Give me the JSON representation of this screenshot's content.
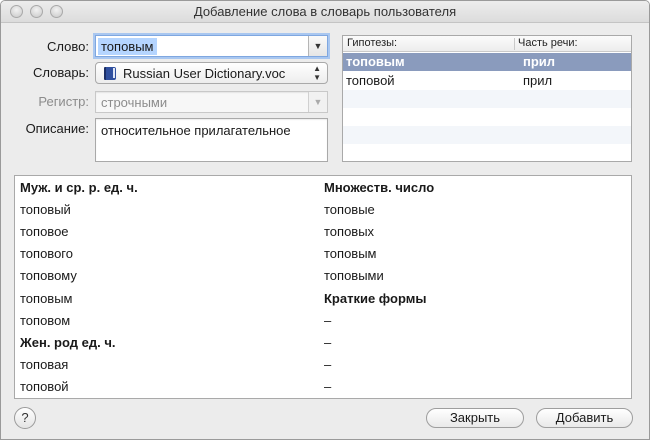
{
  "window": {
    "title": "Добавление слова в словарь пользователя"
  },
  "form": {
    "word_label": "Слово:",
    "word_value": "топовым",
    "dictionary_label": "Словарь:",
    "dictionary_value": "Russian User Dictionary.voc",
    "register_label": "Регистр:",
    "register_value": "строчными",
    "description_label": "Описание:",
    "description_value": "относительное прилагательное"
  },
  "hypotheses": {
    "col_hypotheses": "Гипотезы:",
    "col_pos": "Часть речи:",
    "rows": [
      {
        "word": "топовым",
        "pos": "прил",
        "selected": true
      },
      {
        "word": "топовой",
        "pos": "прил",
        "selected": false
      }
    ]
  },
  "forms": {
    "left": [
      {
        "text": "Муж. и ср. р. ед. ч.",
        "bold": true
      },
      {
        "text": "топовый"
      },
      {
        "text": "топовое"
      },
      {
        "text": "топового"
      },
      {
        "text": "топовому"
      },
      {
        "text": "топовым"
      },
      {
        "text": "топовом"
      },
      {
        "text": "Жен. род ед. ч.",
        "bold": true
      },
      {
        "text": "топовая"
      },
      {
        "text": "топовой"
      }
    ],
    "right": [
      {
        "text": "Множеств. число",
        "bold": true
      },
      {
        "text": "топовые"
      },
      {
        "text": "топовых"
      },
      {
        "text": "топовым"
      },
      {
        "text": "топовыми"
      },
      {
        "text": "Краткие формы",
        "bold": true
      },
      {
        "text": "–"
      },
      {
        "text": "–"
      },
      {
        "text": "–"
      },
      {
        "text": "–"
      }
    ]
  },
  "buttons": {
    "help": "?",
    "close": "Закрыть",
    "add": "Добавить"
  },
  "icons": {
    "close_dot": "window-close-icon",
    "minimize_dot": "window-minimize-icon",
    "zoom_dot": "window-zoom-icon",
    "dictionary": "book-icon",
    "dropdown": "chevron-down-icon",
    "popup": "updown-arrows-icon"
  },
  "colors": {
    "selection": "#8a9bbd",
    "focus_ring": "#a9c7f0",
    "text_highlight": "#b5d5ff"
  }
}
